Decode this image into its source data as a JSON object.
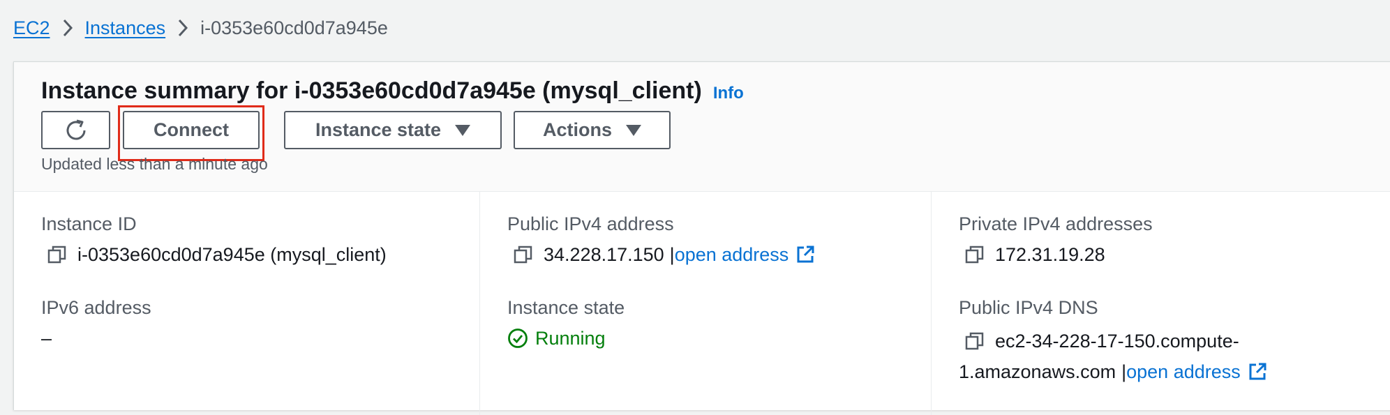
{
  "breadcrumb": {
    "items": [
      {
        "label": "EC2"
      },
      {
        "label": "Instances"
      },
      {
        "label": "i-0353e60cd0d7a945e"
      }
    ]
  },
  "header": {
    "title": "Instance summary for i-0353e60cd0d7a945e (mysql_client)",
    "info_label": "Info",
    "updated_text": "Updated less than a minute ago"
  },
  "toolbar": {
    "refresh_icon": "refresh-icon",
    "connect_label": "Connect",
    "instance_state_label": "Instance state",
    "actions_label": "Actions"
  },
  "details": {
    "instance_id": {
      "label": "Instance ID",
      "value": "i-0353e60cd0d7a945e (mysql_client)"
    },
    "ipv6": {
      "label": "IPv6 address",
      "value": "–"
    },
    "public_ipv4": {
      "label": "Public IPv4 address",
      "value": "34.228.17.150",
      "separator": "|",
      "link": "open address"
    },
    "instance_state": {
      "label": "Instance state",
      "value": "Running"
    },
    "private_ipv4": {
      "label": "Private IPv4 addresses",
      "value": "172.31.19.28"
    },
    "public_dns": {
      "label": "Public IPv4 DNS",
      "value_line1": "ec2-34-228-17-150.compute-",
      "value_line2": "1.amazonaws.com",
      "separator": "|",
      "link": "open address"
    }
  },
  "colors": {
    "link": "#0972d3",
    "success": "#037f0c",
    "highlight": "#e02b19"
  }
}
